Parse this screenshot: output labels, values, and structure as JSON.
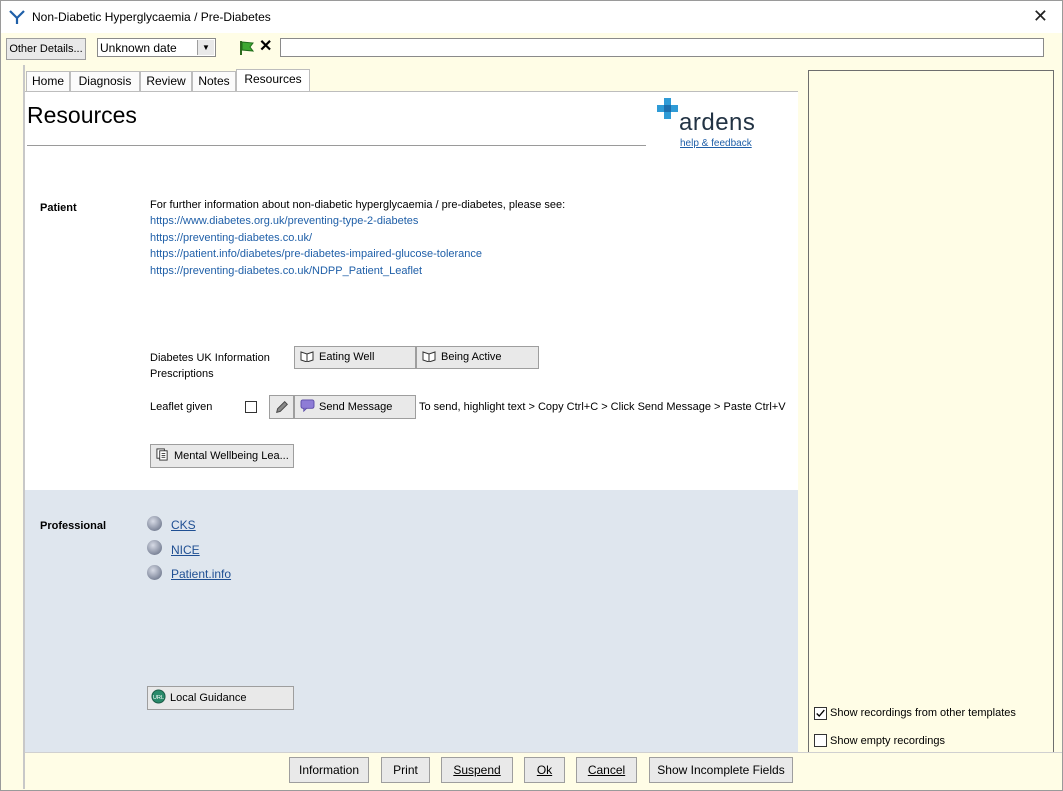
{
  "window": {
    "title": "Non-Diabetic Hyperglycaemia / Pre-Diabetes"
  },
  "toolbar": {
    "other_details_label": "Other Details...",
    "date_value": "Unknown date",
    "note_value": ""
  },
  "tabs": [
    {
      "label": "Home"
    },
    {
      "label": "Diagnosis"
    },
    {
      "label": "Review"
    },
    {
      "label": "Notes"
    },
    {
      "label": "Resources"
    }
  ],
  "content": {
    "page_title": "Resources",
    "logo_text": "ardens",
    "help_link": "help & feedback",
    "patient": {
      "label": "Patient",
      "intro": "For further information about non-diabetic hyperglycaemia / pre-diabetes, please see:",
      "links": [
        "https://www.diabetes.org.uk/preventing-type-2-diabetes",
        "https://preventing-diabetes.co.uk/",
        "https://patient.info/diabetes/pre-diabetes-impaired-glucose-tolerance",
        "https://preventing-diabetes.co.uk/NDPP_Patient_Leaflet"
      ],
      "info_prescriptions_label_1": "Diabetes UK Information",
      "info_prescriptions_label_2": "Prescriptions",
      "eating_well": "Eating Well",
      "being_active": "Being Active",
      "leaflet_given": "Leaflet given",
      "send_message": "Send Message",
      "send_hint": "To send, highlight text > Copy Ctrl+C > Click Send Message > Paste Ctrl+V",
      "mental_wellbeing": "Mental Wellbeing Lea..."
    },
    "professional": {
      "label": "Professional",
      "links": [
        "CKS",
        "NICE",
        "Patient.info"
      ],
      "local_guidance": "Local Guidance"
    }
  },
  "right_panel": {
    "show_other_templates": "Show recordings from other templates",
    "show_other_templates_checked": true,
    "show_empty": "Show empty recordings",
    "show_empty_checked": false
  },
  "bottom_bar": {
    "information": "Information",
    "print": "Print",
    "suspend": "Suspend",
    "ok": "Ok",
    "cancel": "Cancel",
    "show_incomplete": "Show Incomplete Fields"
  }
}
